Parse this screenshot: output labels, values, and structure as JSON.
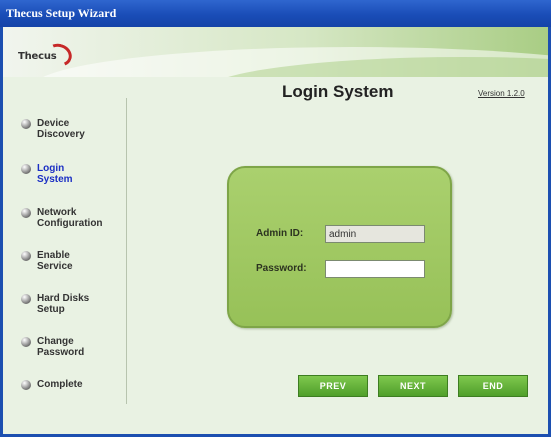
{
  "window": {
    "title": "Thecus Setup Wizard"
  },
  "logo": {
    "text": "Thecus"
  },
  "sidebar": {
    "items": [
      {
        "line1": "Device",
        "line2": "Discovery",
        "active": false
      },
      {
        "line1": "Login",
        "line2": "System",
        "active": true
      },
      {
        "line1": "Network",
        "line2": "Configuration",
        "active": false
      },
      {
        "line1": "Enable",
        "line2": "Service",
        "active": false
      },
      {
        "line1": "Hard Disks",
        "line2": "Setup",
        "active": false
      },
      {
        "line1": "Change",
        "line2": "Password",
        "active": false
      },
      {
        "line1": "Complete",
        "line2": "",
        "active": false
      }
    ]
  },
  "main": {
    "title": "Login System",
    "version": "Version 1.2.0"
  },
  "login": {
    "admin_label": "Admin ID:",
    "admin_value": "admin",
    "password_label": "Password:",
    "password_value": ""
  },
  "buttons": {
    "prev": "PREV",
    "next": "NEXT",
    "end": "END"
  },
  "colors": {
    "titlebar": "#1a4db7",
    "active_step": "#1b2fc4",
    "panel": "#9fc862",
    "button": "#5aab31"
  }
}
